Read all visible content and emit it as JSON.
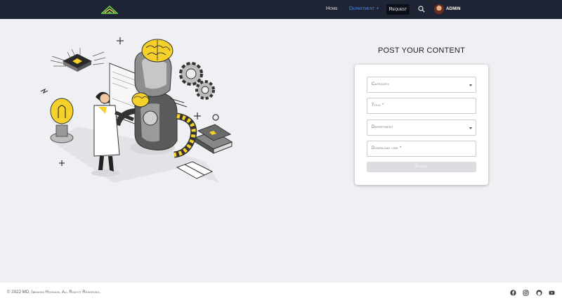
{
  "nav": {
    "logo_icon": "book-logo-icon",
    "home": "Home",
    "department": "Department +",
    "request": "Request",
    "search_icon": "search-icon",
    "user": "ADMIN"
  },
  "form": {
    "title": "POST YOUR CONTENT",
    "category_placeholder": "Category",
    "title_placeholder": "Title *",
    "department_placeholder": "Department",
    "download_placeholder": "Download link *",
    "submit": "Submit"
  },
  "footer": {
    "copyright": "© 2022 MD. Ibrahim Hossain. All Rights Reserved.",
    "social": [
      "facebook-icon",
      "instagram-icon",
      "github-icon",
      "youtube-icon"
    ]
  },
  "colors": {
    "navbar": "#1e2433",
    "accent_link": "#4a8ef5",
    "illustration_yellow": "#f5d12a",
    "background": "#eef0f3"
  }
}
